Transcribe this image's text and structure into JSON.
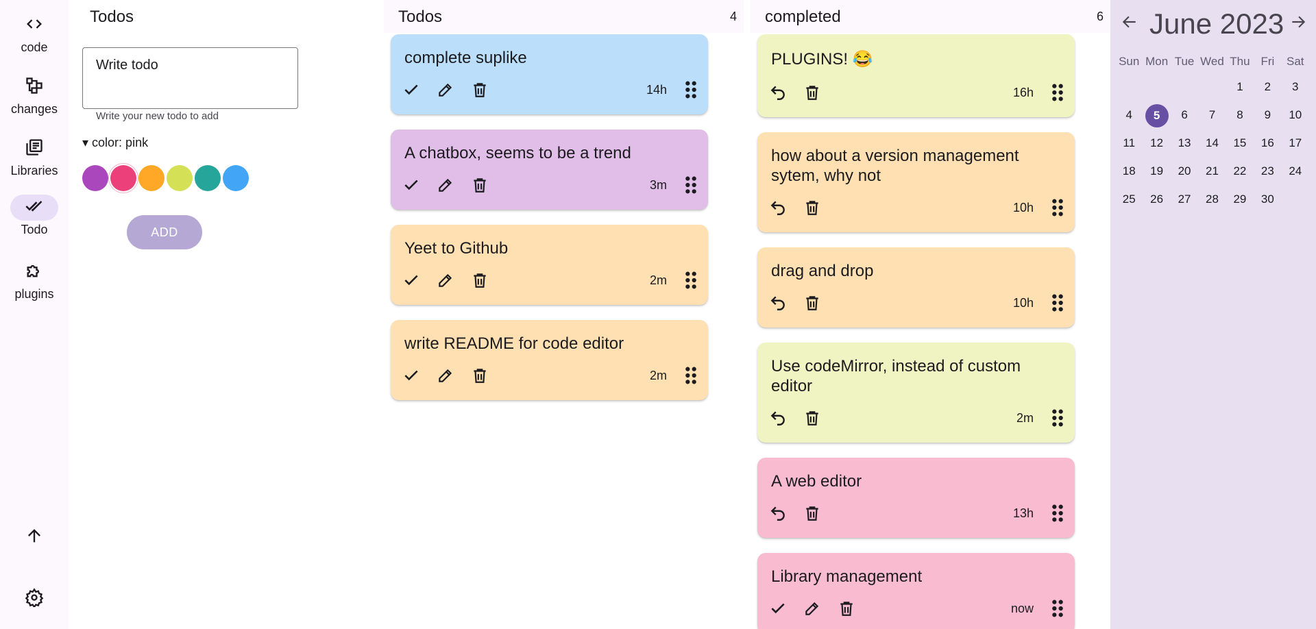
{
  "nav": {
    "items": [
      {
        "label": "code",
        "icon": "code-icon"
      },
      {
        "label": "changes",
        "icon": "changes-icon"
      },
      {
        "label": "Libraries",
        "icon": "libraries-icon"
      },
      {
        "label": "Todo",
        "icon": "todo-check-icon",
        "active": true
      },
      {
        "label": "plugins",
        "icon": "puzzle-icon"
      }
    ],
    "bottom_icons": [
      "arrow-up-icon",
      "settings-icon"
    ]
  },
  "add_panel": {
    "title": "Todos",
    "input_value": "Write todo",
    "input_help": "Write your new todo to add",
    "color_summary": "▾ color: pink",
    "swatches": [
      "#ab47bc",
      "#ec407a",
      "#ffa726",
      "#d4e157",
      "#26a69a",
      "#42a5f5"
    ],
    "selected_color": "pink",
    "add_label": "ADD"
  },
  "todos": {
    "title": "Todos",
    "count": "4",
    "cards": [
      {
        "text": "complete suplike",
        "time": "14h",
        "color": "#bbdefb"
      },
      {
        "text": "A chatbox, seems to be a trend",
        "time": "3m",
        "color": "#e1bee7"
      },
      {
        "text": "Yeet to Github",
        "time": "2m",
        "color": "#ffe0b2"
      },
      {
        "text": "write README for code editor",
        "time": "2m",
        "color": "#ffe0b2"
      }
    ]
  },
  "completed": {
    "title": "completed",
    "count": "6",
    "cards": [
      {
        "text": "PLUGINS! 😂",
        "time": "16h",
        "color": "#f0f4c3"
      },
      {
        "text": "how about a version management sytem, why not",
        "time": "10h",
        "color": "#ffe0b2"
      },
      {
        "text": "drag and drop",
        "time": "10h",
        "color": "#ffe0b2"
      },
      {
        "text": "Use codeMirror, instead of custom editor",
        "time": "2m",
        "color": "#f0f4c3"
      },
      {
        "text": "A web editor",
        "time": "13h",
        "color": "#f8bbd0"
      },
      {
        "text": "Library management",
        "time": "now",
        "color": "#f8bbd0"
      }
    ]
  },
  "calendar": {
    "title": "June 2023",
    "weekdays": [
      "Sun",
      "Mon",
      "Tue",
      "Wed",
      "Thu",
      "Fri",
      "Sat"
    ],
    "today": "5",
    "days": [
      "",
      "",
      "",
      "",
      "1",
      "2",
      "3",
      "4",
      "5",
      "6",
      "7",
      "8",
      "9",
      "10",
      "11",
      "12",
      "13",
      "14",
      "15",
      "16",
      "17",
      "18",
      "19",
      "20",
      "21",
      "22",
      "23",
      "24",
      "25",
      "26",
      "27",
      "28",
      "29",
      "30",
      ""
    ]
  }
}
